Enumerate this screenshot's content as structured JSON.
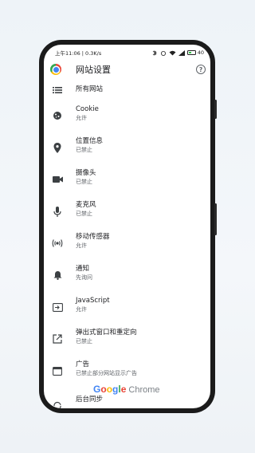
{
  "status_bar": {
    "time": "上午11:06 | 0.3K/s",
    "battery": "40",
    "battery_level": 0.4
  },
  "header": {
    "title": "网站设置",
    "help_glyph": "?"
  },
  "items": [
    {
      "label": "所有网站",
      "sub": "",
      "icon": "list-icon"
    },
    {
      "label": "Cookie",
      "sub": "允许",
      "icon": "cookie-icon"
    },
    {
      "label": "位置信息",
      "sub": "已禁止",
      "icon": "location-pin-icon"
    },
    {
      "label": "摄像头",
      "sub": "已禁止",
      "icon": "videocam-icon"
    },
    {
      "label": "麦克风",
      "sub": "已禁止",
      "icon": "microphone-icon"
    },
    {
      "label": "移动传感器",
      "sub": "允许",
      "icon": "sensors-icon"
    },
    {
      "label": "通知",
      "sub": "先询问",
      "icon": "bell-icon"
    },
    {
      "label": "JavaScript",
      "sub": "允许",
      "icon": "javascript-icon"
    },
    {
      "label": "弹出式窗口和重定向",
      "sub": "已禁止",
      "icon": "open-external-icon"
    },
    {
      "label": "广告",
      "sub": "已禁止部分网站显示广告",
      "icon": "ad-window-icon"
    },
    {
      "label": "后台同步",
      "sub": "",
      "icon": "sync-icon"
    }
  ],
  "watermark": {
    "google": "Google",
    "chrome": "Chrome"
  },
  "colors": {
    "google_blue": "#4285f4",
    "google_red": "#ea4335",
    "google_yellow": "#fbbc05",
    "google_green": "#34a853",
    "icon_gray": "#3c4043"
  }
}
